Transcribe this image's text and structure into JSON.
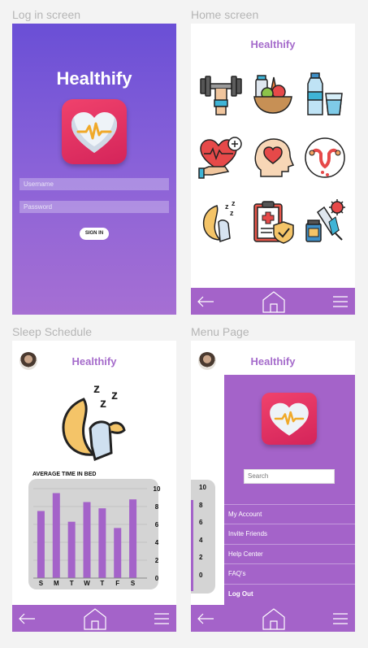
{
  "panels": {
    "login_label": "Log in screen",
    "home_label": "Home screen",
    "sleep_label": "Sleep Schedule",
    "menu_label": "Menu Page"
  },
  "app_name": "Healthify",
  "login": {
    "username_placeholder": "Username",
    "password_placeholder": "Password",
    "signin_label": "SIGN IN"
  },
  "home": {
    "icons": [
      "dumbbell-icon",
      "healthy-food-icon",
      "water-bottle-icon",
      "heart-care-icon",
      "mental-health-icon",
      "uterus-icon",
      "sleep-moon-icon",
      "medical-insurance-icon",
      "vaccine-icon"
    ]
  },
  "sleep": {
    "chart_title": "AVERAGE TIME IN BED"
  },
  "menu": {
    "search_placeholder": "Search",
    "items": [
      "My Account",
      "Invite Friends",
      "Help Center",
      "FAQ's",
      "Log Out"
    ]
  },
  "colors": {
    "accent": "#a463c9",
    "login_top": "#6a4fd6",
    "login_bottom": "#a66fd3",
    "icon_red": "#e12e5e"
  },
  "chart_data": {
    "type": "bar",
    "title": "AVERAGE TIME IN BED",
    "categories": [
      "S",
      "M",
      "T",
      "W",
      "T",
      "F",
      "S"
    ],
    "values": [
      7.5,
      9.5,
      6.3,
      8.5,
      7.8,
      5.6,
      8.8
    ],
    "yticks": [
      "10",
      "8",
      "6",
      "4",
      "2",
      "0"
    ],
    "ylim": [
      0,
      10
    ],
    "grid": true
  },
  "menu_axis_ticks": [
    "10",
    "8",
    "6",
    "4",
    "2",
    "0"
  ]
}
